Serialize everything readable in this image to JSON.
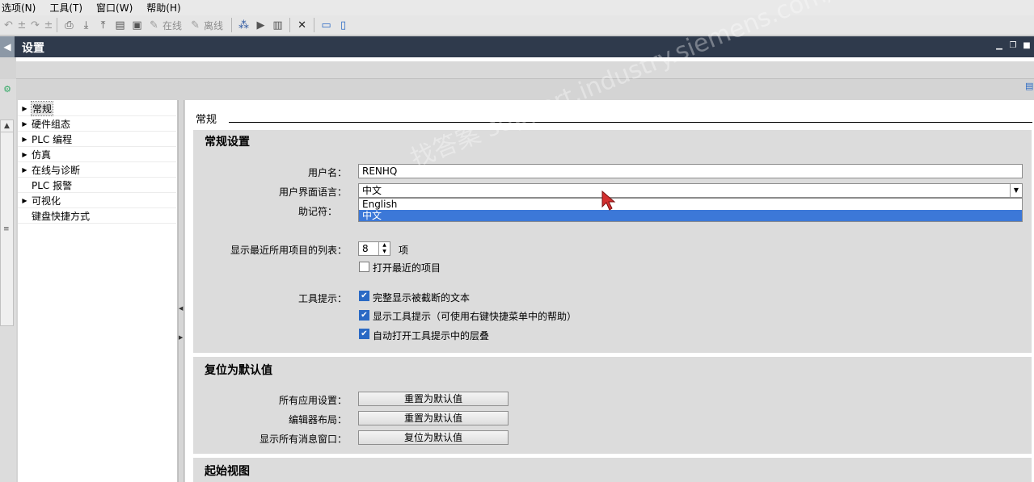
{
  "menu": [
    "选项(N)",
    "工具(T)",
    "窗口(W)",
    "帮助(H)"
  ],
  "toolbar": {
    "online": "在线",
    "offline": "离线"
  },
  "window": {
    "title": "设置"
  },
  "nav": {
    "items": [
      {
        "label": "常规",
        "arrow": "▶",
        "selected": true
      },
      {
        "label": "硬件组态",
        "arrow": "▶",
        "selected": false
      },
      {
        "label": "PLC 编程",
        "arrow": "▶",
        "selected": false
      },
      {
        "label": "仿真",
        "arrow": "▶",
        "selected": false
      },
      {
        "label": "在线与诊断",
        "arrow": "▶",
        "selected": false
      },
      {
        "label": "PLC 报警",
        "arrow": "",
        "selected": false
      },
      {
        "label": "可视化",
        "arrow": "▶",
        "selected": false
      },
      {
        "label": "键盘快捷方式",
        "arrow": "",
        "selected": false
      }
    ]
  },
  "content": {
    "heading": "常规",
    "general": {
      "title": "常规设置",
      "username_label": "用户名：",
      "username_value": "RENHQ",
      "language_label": "用户界面语言：",
      "language_value": "中文",
      "language_options": [
        "English",
        "中文"
      ],
      "mnemonic_label": "助记符：",
      "recent_label": "显示最近所用项目的列表：",
      "recent_value": "8",
      "recent_unit": "项",
      "open_recent_label": "打开最近的项目",
      "tooltip_label": "工具提示：",
      "tooltip_options": [
        {
          "label": "完整显示被截断的文本",
          "checked": true
        },
        {
          "label": "显示工具提示（可使用右键快捷菜单中的帮助）",
          "checked": true
        },
        {
          "label": "自动打开工具提示中的层叠",
          "checked": true
        }
      ]
    },
    "reset": {
      "title": "复位为默认值",
      "rows": [
        {
          "label": "所有应用设置：",
          "button": "重置为默认值"
        },
        {
          "label": "编辑器布局：",
          "button": "重置为默认值"
        },
        {
          "label": "显示所有消息窗口：",
          "button": "复位为默认值"
        }
      ]
    },
    "start_view": {
      "title": "起始视图"
    }
  },
  "watermark": "找答案 support.industry.siemens.com/cs"
}
